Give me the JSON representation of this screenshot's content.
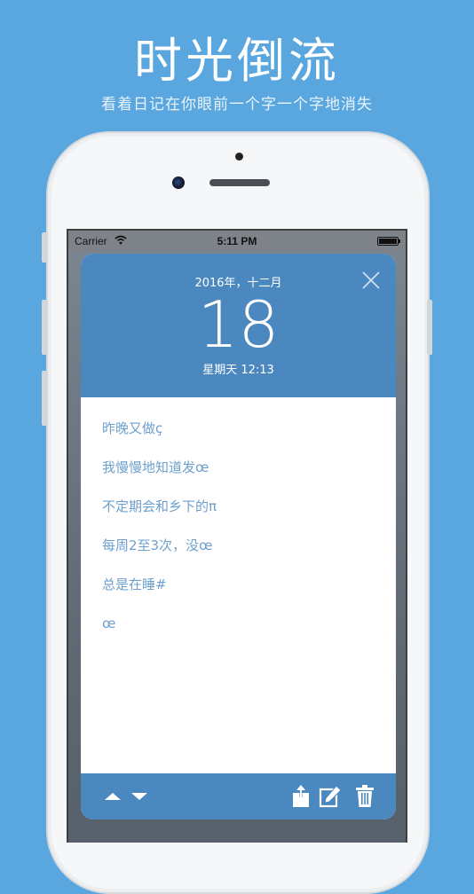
{
  "promo": {
    "title": "时光倒流",
    "subtitle": "看着日记在你眼前一个字一个字地消失"
  },
  "status_bar": {
    "carrier": "Carrier",
    "time": "5:11 PM"
  },
  "entry": {
    "date_line": "2016年，十二月",
    "day": "18",
    "weekday_time": "星期天 12:13",
    "lines": [
      "昨晚又做ç",
      "我慢慢地知道发œ",
      "不定期会和乡下的π",
      "每周2至3次，没œ",
      "总是在睡#",
      "œ"
    ]
  },
  "icons": {
    "close": "close-icon",
    "previous": "arrow-up-icon",
    "next": "arrow-down-icon",
    "share": "share-icon",
    "edit": "edit-icon",
    "delete": "trash-icon"
  },
  "colors": {
    "background": "#5aa7df",
    "card_header": "#4b88bf",
    "text_line": "#6e9fcc"
  }
}
